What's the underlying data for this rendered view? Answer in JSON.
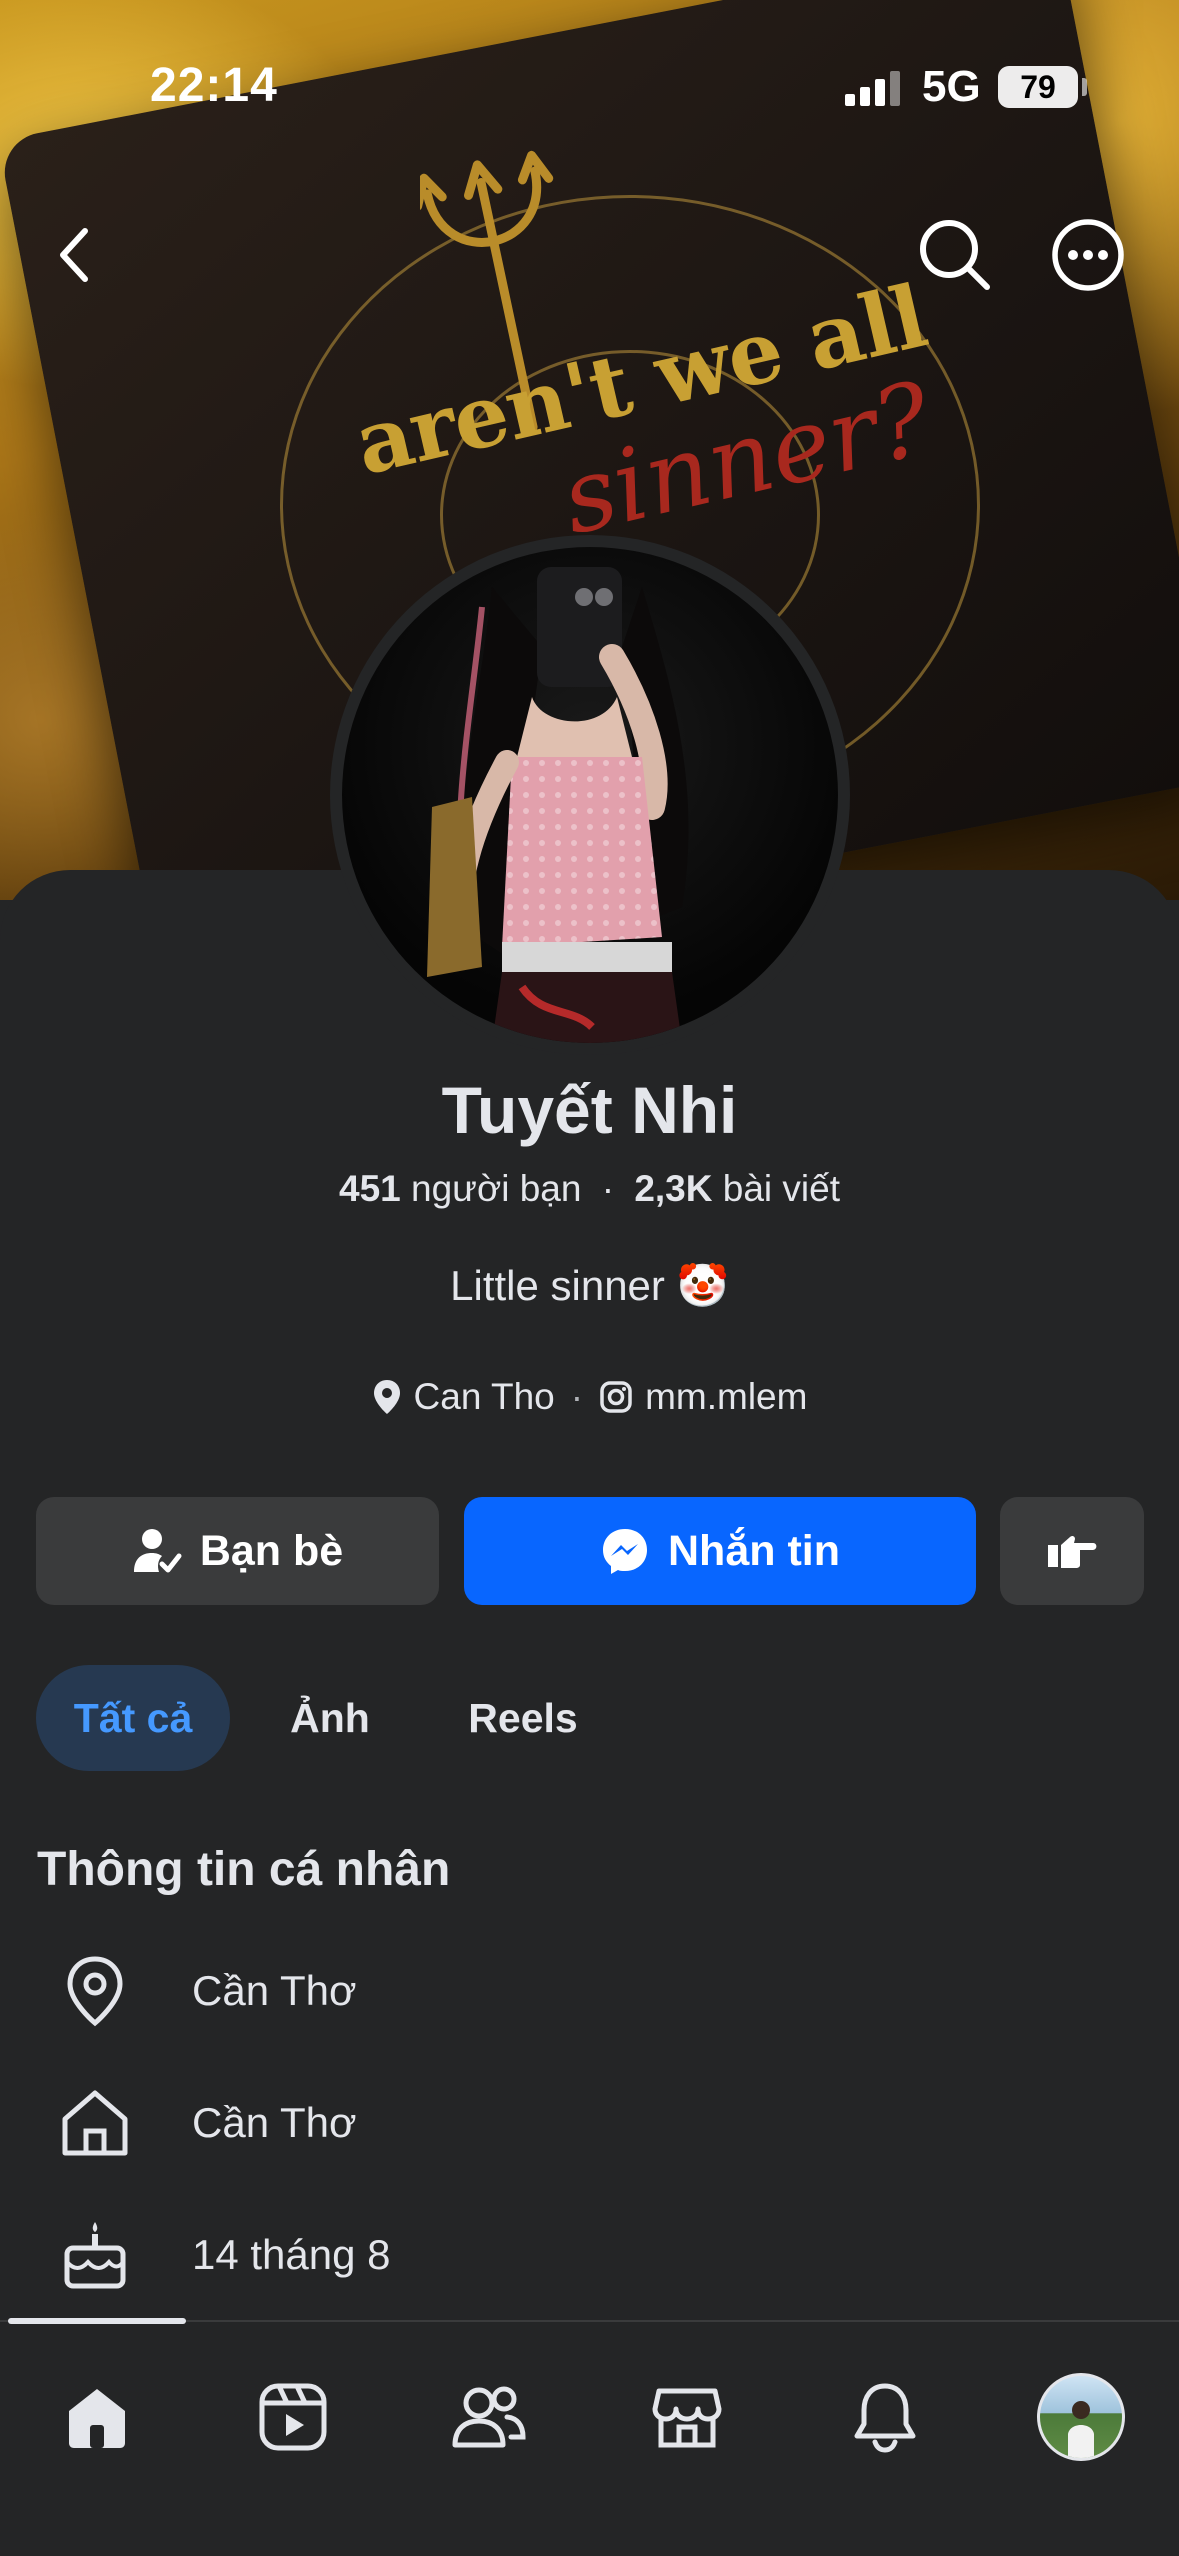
{
  "status_bar": {
    "time": "22:14",
    "network": "5G",
    "battery": "79"
  },
  "cover": {
    "text_main": "aren't we all",
    "text_script": "sinner?"
  },
  "profile": {
    "name": "Tuyết Nhi",
    "friends_count": "451",
    "friends_label": "người bạn",
    "separator": "·",
    "posts_count": "2,3K",
    "posts_label": "bài viết",
    "bio_text": "Little sinner",
    "bio_emoji": "🤡",
    "location": "Can Tho",
    "instagram": "mm.mlem"
  },
  "actions": {
    "friends_label": "Bạn bè",
    "message_label": "Nhắn tin"
  },
  "tabs": [
    {
      "label": "Tất cả",
      "active": true
    },
    {
      "label": "Ảnh",
      "active": false
    },
    {
      "label": "Reels",
      "active": false
    }
  ],
  "personal_info": {
    "title": "Thông tin cá nhân",
    "items": [
      {
        "icon": "location-pin-icon",
        "text": "Cần Thơ"
      },
      {
        "icon": "home-icon",
        "text": "Cần Thơ"
      },
      {
        "icon": "birthday-cake-icon",
        "text": "14 tháng 8"
      }
    ]
  },
  "bottom_nav": [
    {
      "icon": "home-icon",
      "active": true
    },
    {
      "icon": "video-icon",
      "active": false
    },
    {
      "icon": "friends-icon",
      "active": false
    },
    {
      "icon": "marketplace-icon",
      "active": false
    },
    {
      "icon": "bell-icon",
      "active": false
    },
    {
      "icon": "profile-avatar",
      "active": false
    }
  ],
  "colors": {
    "background": "#242526",
    "accent_blue": "#0866ff",
    "tab_active_bg": "#263951",
    "tab_active_text": "#4599ff",
    "button_gray": "#3a3b3c"
  }
}
